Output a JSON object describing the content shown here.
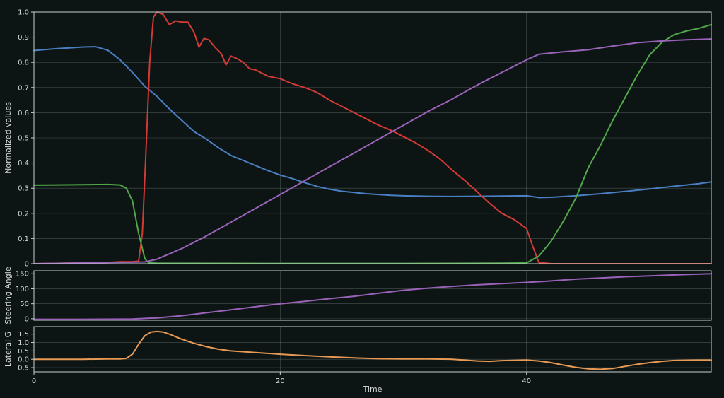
{
  "chart_data": [
    {
      "type": "line",
      "ylabel": "Normalized values",
      "xlim": [
        0,
        55
      ],
      "ylim": [
        0,
        1.0
      ],
      "yticks": [
        "0",
        "0.1",
        "0.2",
        "0.3",
        "0.4",
        "0.5",
        "0.6",
        "0.7",
        "0.8",
        "0.9",
        "1.0"
      ],
      "grid": true,
      "series": [
        {
          "color": "#4a7fc4",
          "points": [
            [
              0,
              0.847
            ],
            [
              1,
              0.851
            ],
            [
              2,
              0.855
            ],
            [
              3,
              0.858
            ],
            [
              4,
              0.861
            ],
            [
              5,
              0.862
            ],
            [
              6,
              0.848
            ],
            [
              7,
              0.81
            ],
            [
              8,
              0.76
            ],
            [
              9,
              0.705
            ],
            [
              10,
              0.665
            ],
            [
              11,
              0.615
            ],
            [
              12,
              0.57
            ],
            [
              13,
              0.525
            ],
            [
              14,
              0.495
            ],
            [
              15,
              0.46
            ],
            [
              16,
              0.43
            ],
            [
              17,
              0.41
            ],
            [
              18,
              0.39
            ],
            [
              19,
              0.37
            ],
            [
              20,
              0.352
            ],
            [
              21,
              0.338
            ],
            [
              22,
              0.322
            ],
            [
              23,
              0.307
            ],
            [
              24,
              0.296
            ],
            [
              25,
              0.288
            ],
            [
              26,
              0.283
            ],
            [
              27,
              0.278
            ],
            [
              28,
              0.275
            ],
            [
              29,
              0.272
            ],
            [
              30,
              0.27
            ],
            [
              32,
              0.268
            ],
            [
              34,
              0.267
            ],
            [
              36,
              0.268
            ],
            [
              38,
              0.269
            ],
            [
              40,
              0.27
            ],
            [
              41,
              0.263
            ],
            [
              42,
              0.264
            ],
            [
              44,
              0.27
            ],
            [
              46,
              0.278
            ],
            [
              48,
              0.287
            ],
            [
              50,
              0.297
            ],
            [
              52,
              0.308
            ],
            [
              54,
              0.318
            ],
            [
              55,
              0.325
            ]
          ]
        },
        {
          "color": "#d23a35",
          "points": [
            [
              0,
              0
            ],
            [
              4,
              0.003
            ],
            [
              6,
              0.005
            ],
            [
              7,
              0.008
            ],
            [
              8,
              0.008
            ],
            [
              8.5,
              0.01
            ],
            [
              8.8,
              0.12
            ],
            [
              9.1,
              0.45
            ],
            [
              9.4,
              0.8
            ],
            [
              9.7,
              0.98
            ],
            [
              10,
              1.0
            ],
            [
              10.5,
              0.99
            ],
            [
              11,
              0.95
            ],
            [
              11.5,
              0.965
            ],
            [
              12,
              0.96
            ],
            [
              12.5,
              0.96
            ],
            [
              13,
              0.92
            ],
            [
              13.4,
              0.86
            ],
            [
              13.8,
              0.895
            ],
            [
              14.2,
              0.89
            ],
            [
              14.7,
              0.86
            ],
            [
              15.2,
              0.835
            ],
            [
              15.6,
              0.79
            ],
            [
              16,
              0.825
            ],
            [
              16.5,
              0.815
            ],
            [
              17,
              0.8
            ],
            [
              17.5,
              0.775
            ],
            [
              18,
              0.77
            ],
            [
              19,
              0.745
            ],
            [
              20,
              0.735
            ],
            [
              21,
              0.715
            ],
            [
              22,
              0.7
            ],
            [
              23,
              0.68
            ],
            [
              24,
              0.65
            ],
            [
              25,
              0.625
            ],
            [
              26,
              0.6
            ],
            [
              27,
              0.575
            ],
            [
              28,
              0.55
            ],
            [
              29,
              0.53
            ],
            [
              30,
              0.505
            ],
            [
              31,
              0.48
            ],
            [
              32,
              0.45
            ],
            [
              33,
              0.415
            ],
            [
              34,
              0.37
            ],
            [
              35,
              0.33
            ],
            [
              36,
              0.285
            ],
            [
              37,
              0.24
            ],
            [
              38,
              0.2
            ],
            [
              39,
              0.175
            ],
            [
              40,
              0.14
            ],
            [
              40.5,
              0.07
            ],
            [
              41,
              0.005
            ],
            [
              42,
              0
            ],
            [
              55,
              0
            ]
          ]
        },
        {
          "color": "#51a84a",
          "points": [
            [
              0,
              0.312
            ],
            [
              2,
              0.313
            ],
            [
              4,
              0.314
            ],
            [
              6,
              0.315
            ],
            [
              7,
              0.313
            ],
            [
              7.5,
              0.3
            ],
            [
              8,
              0.25
            ],
            [
              8.5,
              0.12
            ],
            [
              9,
              0.02
            ],
            [
              9.3,
              0.003
            ],
            [
              10,
              0.002
            ],
            [
              20,
              0.001
            ],
            [
              30,
              0.001
            ],
            [
              38,
              0.002
            ],
            [
              40,
              0.003
            ],
            [
              41,
              0.03
            ],
            [
              42,
              0.09
            ],
            [
              43,
              0.17
            ],
            [
              44,
              0.26
            ],
            [
              45,
              0.38
            ],
            [
              46,
              0.47
            ],
            [
              47,
              0.57
            ],
            [
              48,
              0.66
            ],
            [
              49,
              0.75
            ],
            [
              50,
              0.83
            ],
            [
              51,
              0.88
            ],
            [
              52,
              0.91
            ],
            [
              53,
              0.925
            ],
            [
              54,
              0.935
            ],
            [
              55,
              0.95
            ]
          ]
        },
        {
          "color": "#9a62b8",
          "points": [
            [
              0,
              0
            ],
            [
              4,
              0.003
            ],
            [
              6,
              0.005
            ],
            [
              8,
              0.006
            ],
            [
              9,
              0.007
            ],
            [
              10,
              0.018
            ],
            [
              12,
              0.06
            ],
            [
              14,
              0.11
            ],
            [
              16,
              0.165
            ],
            [
              18,
              0.22
            ],
            [
              20,
              0.275
            ],
            [
              22,
              0.33
            ],
            [
              24,
              0.385
            ],
            [
              26,
              0.44
            ],
            [
              28,
              0.495
            ],
            [
              30,
              0.55
            ],
            [
              32,
              0.605
            ],
            [
              34,
              0.655
            ],
            [
              36,
              0.71
            ],
            [
              38,
              0.76
            ],
            [
              40,
              0.81
            ],
            [
              41,
              0.832
            ],
            [
              43,
              0.842
            ],
            [
              45,
              0.85
            ],
            [
              47,
              0.865
            ],
            [
              49,
              0.878
            ],
            [
              51,
              0.885
            ],
            [
              53,
              0.89
            ],
            [
              55,
              0.893
            ]
          ]
        }
      ]
    },
    {
      "type": "line",
      "ylabel": "Steering Angle",
      "xlim": [
        0,
        55
      ],
      "ylim": [
        -5,
        160
      ],
      "yticks": [
        "0",
        "50",
        "100",
        "150"
      ],
      "grid": true,
      "series": [
        {
          "color": "#9a62b8",
          "points": [
            [
              0,
              -2
            ],
            [
              4,
              -2
            ],
            [
              8,
              -1
            ],
            [
              10,
              3
            ],
            [
              12,
              10
            ],
            [
              14,
              20
            ],
            [
              16,
              30
            ],
            [
              18,
              40
            ],
            [
              20,
              50
            ],
            [
              22,
              58
            ],
            [
              24,
              67
            ],
            [
              26,
              75
            ],
            [
              28,
              85
            ],
            [
              30,
              95
            ],
            [
              32,
              102
            ],
            [
              34,
              108
            ],
            [
              36,
              113
            ],
            [
              38,
              117
            ],
            [
              40,
              121
            ],
            [
              42,
              126
            ],
            [
              44,
              132
            ],
            [
              46,
              136
            ],
            [
              48,
              140
            ],
            [
              50,
              143
            ],
            [
              52,
              146
            ],
            [
              55,
              150
            ]
          ]
        }
      ]
    },
    {
      "type": "line",
      "ylabel": "Lateral G",
      "xlim": [
        0,
        55
      ],
      "ylim": [
        -0.75,
        1.95
      ],
      "yticks": [
        "-0.5",
        "0.0",
        "0.5",
        "1.0",
        "1.5"
      ],
      "grid": true,
      "series": [
        {
          "color": "#e89a55",
          "points": [
            [
              0,
              0
            ],
            [
              2,
              0
            ],
            [
              4,
              0
            ],
            [
              6,
              0.02
            ],
            [
              7,
              0.02
            ],
            [
              7.5,
              0.05
            ],
            [
              8,
              0.3
            ],
            [
              8.5,
              0.9
            ],
            [
              9,
              1.4
            ],
            [
              9.5,
              1.62
            ],
            [
              10,
              1.66
            ],
            [
              10.5,
              1.62
            ],
            [
              11,
              1.5
            ],
            [
              12,
              1.2
            ],
            [
              13,
              0.95
            ],
            [
              14,
              0.75
            ],
            [
              15,
              0.6
            ],
            [
              16,
              0.5
            ],
            [
              18,
              0.4
            ],
            [
              20,
              0.3
            ],
            [
              22,
              0.22
            ],
            [
              24,
              0.15
            ],
            [
              26,
              0.08
            ],
            [
              28,
              0.03
            ],
            [
              30,
              0.02
            ],
            [
              32,
              0.02
            ],
            [
              34,
              0
            ],
            [
              36,
              -0.1
            ],
            [
              37,
              -0.12
            ],
            [
              38,
              -0.08
            ],
            [
              40,
              -0.05
            ],
            [
              41,
              -0.1
            ],
            [
              42,
              -0.2
            ],
            [
              43,
              -0.35
            ],
            [
              44,
              -0.48
            ],
            [
              45,
              -0.57
            ],
            [
              46,
              -0.6
            ],
            [
              47,
              -0.55
            ],
            [
              48,
              -0.42
            ],
            [
              49,
              -0.3
            ],
            [
              50,
              -0.2
            ],
            [
              51,
              -0.12
            ],
            [
              52,
              -0.07
            ],
            [
              54,
              -0.05
            ],
            [
              55,
              -0.05
            ]
          ]
        }
      ]
    }
  ],
  "xaxis": {
    "label": "Time",
    "ticks": [
      "0",
      "20",
      "40"
    ]
  }
}
